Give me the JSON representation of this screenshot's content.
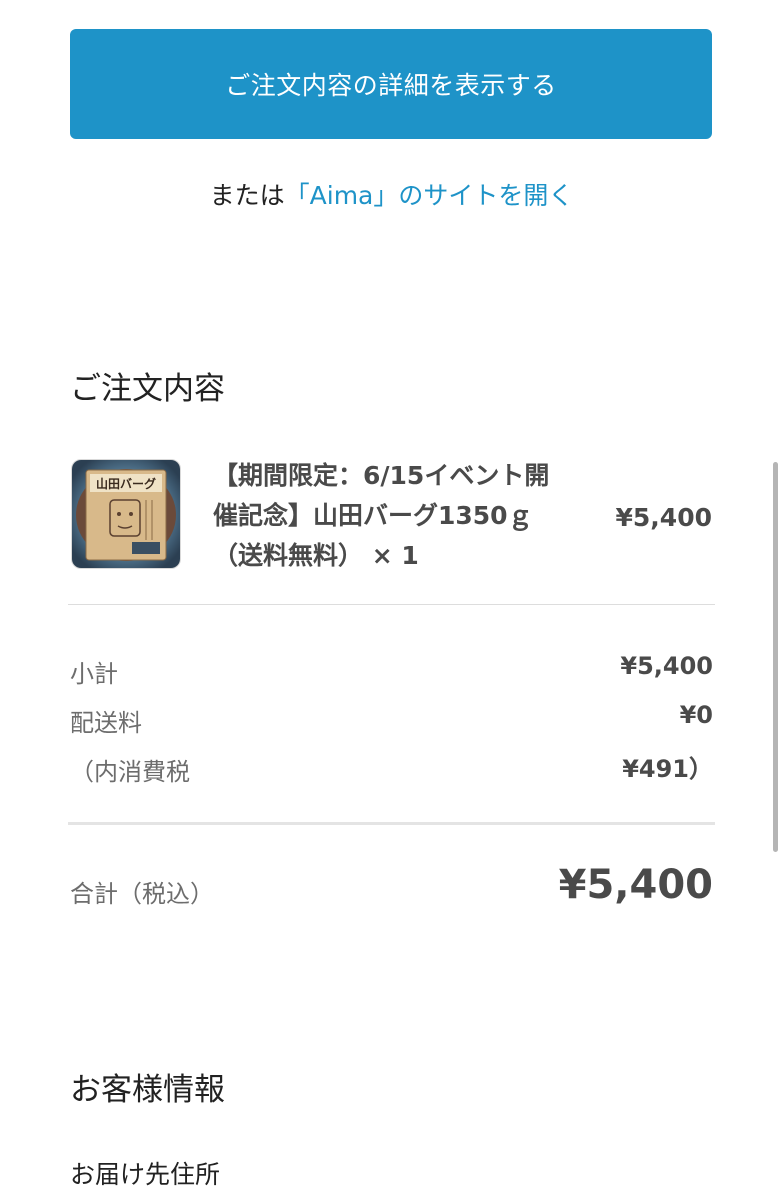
{
  "actions": {
    "primary_button": "ご注文内容の詳細を表示する",
    "alt_prefix": "または",
    "alt_link": "「Aima」のサイトを開く"
  },
  "order_summary": {
    "title": "ご注文内容",
    "item": {
      "name_line1": "【期間限定：6/15イベント開",
      "name_line2": "催記念】山田バーグ1350ｇ",
      "name_line3": "（送料無料） × 1",
      "price": "¥5,400",
      "image_label": "山田バーグ"
    },
    "subtotal_label": "小計",
    "subtotal_value": "¥5,400",
    "shipping_label": "配送料",
    "shipping_value": "¥0",
    "tax_label": "（内消費税",
    "tax_value": "¥491）",
    "total_label": "合計（税込）",
    "total_value": "¥5,400"
  },
  "customer_info": {
    "title": "お客様情報",
    "shipping_address_label": "お届け先住所"
  },
  "colors": {
    "accent": "#1e93c8",
    "text_dark": "#222222",
    "text_muted": "#6d6d6d"
  }
}
